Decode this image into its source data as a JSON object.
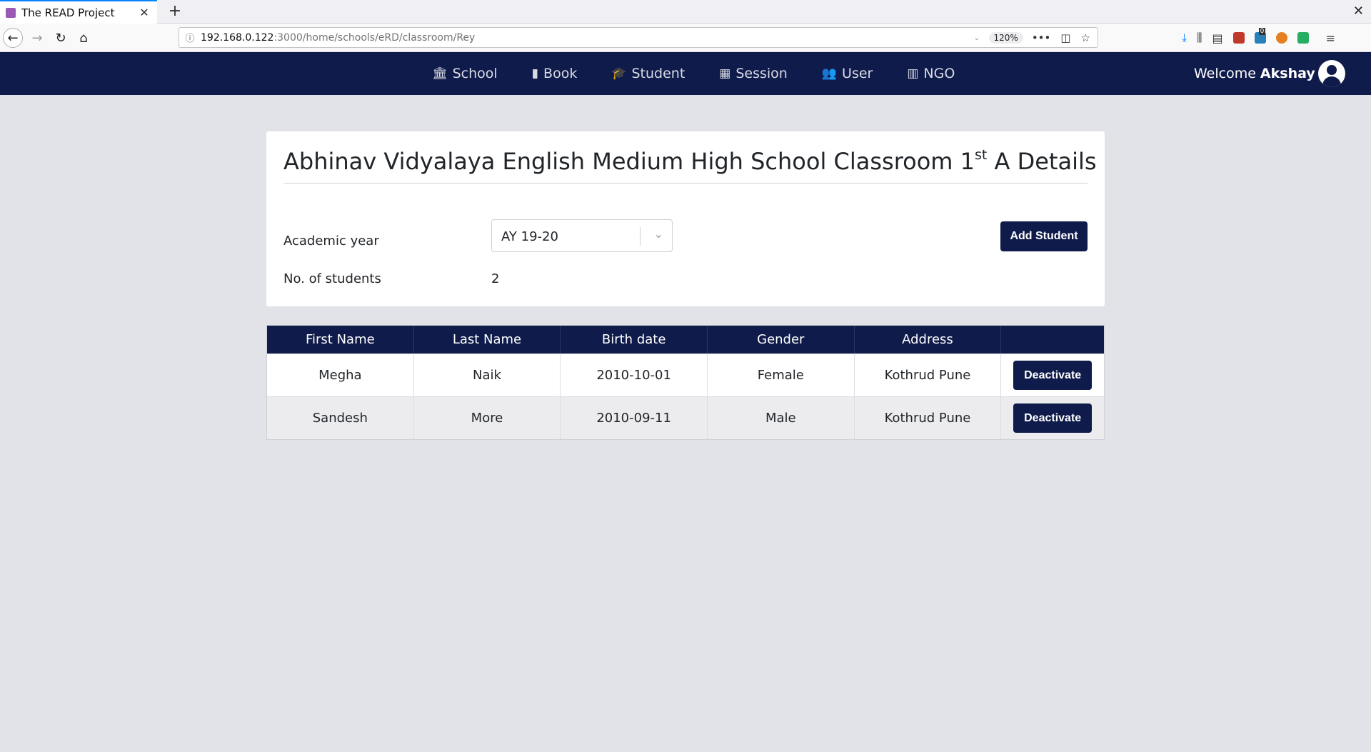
{
  "browser": {
    "tab_title": "The READ Project",
    "url_host": "192.168.0.122",
    "url_path": ":3000/home/schools/eRD/classroom/Rey",
    "zoom": "120%",
    "notification_count": "0"
  },
  "nav": {
    "items": [
      {
        "label": "School",
        "icon": "bank-icon"
      },
      {
        "label": "Book",
        "icon": "book-icon"
      },
      {
        "label": "Student",
        "icon": "graduation-cap-icon"
      },
      {
        "label": "Session",
        "icon": "calendar-icon"
      },
      {
        "label": "User",
        "icon": "users-icon"
      },
      {
        "label": "NGO",
        "icon": "building-icon"
      }
    ],
    "welcome": "Welcome",
    "user_name": "Akshay"
  },
  "details": {
    "title_prefix": "Abhinav Vidyalaya English Medium High School Classroom 1",
    "title_sup": "st",
    "title_suffix": " A Details",
    "academic_year_label": "Academic year",
    "academic_year_value": "AY 19-20",
    "add_student_label": "Add Student",
    "student_count_label": "No. of students",
    "student_count_value": "2"
  },
  "table": {
    "headers": [
      "First Name",
      "Last Name",
      "Birth date",
      "Gender",
      "Address",
      ""
    ],
    "rows": [
      {
        "first_name": "Megha",
        "last_name": "Naik",
        "birth_date": "2010-10-01",
        "gender": "Female",
        "address": "Kothrud Pune",
        "action": "Deactivate"
      },
      {
        "first_name": "Sandesh",
        "last_name": "More",
        "birth_date": "2010-09-11",
        "gender": "Male",
        "address": "Kothrud Pune",
        "action": "Deactivate"
      }
    ]
  },
  "colors": {
    "navbar": "#0f1b4a",
    "background": "#e1e3e8",
    "row_alt": "#ececef"
  }
}
